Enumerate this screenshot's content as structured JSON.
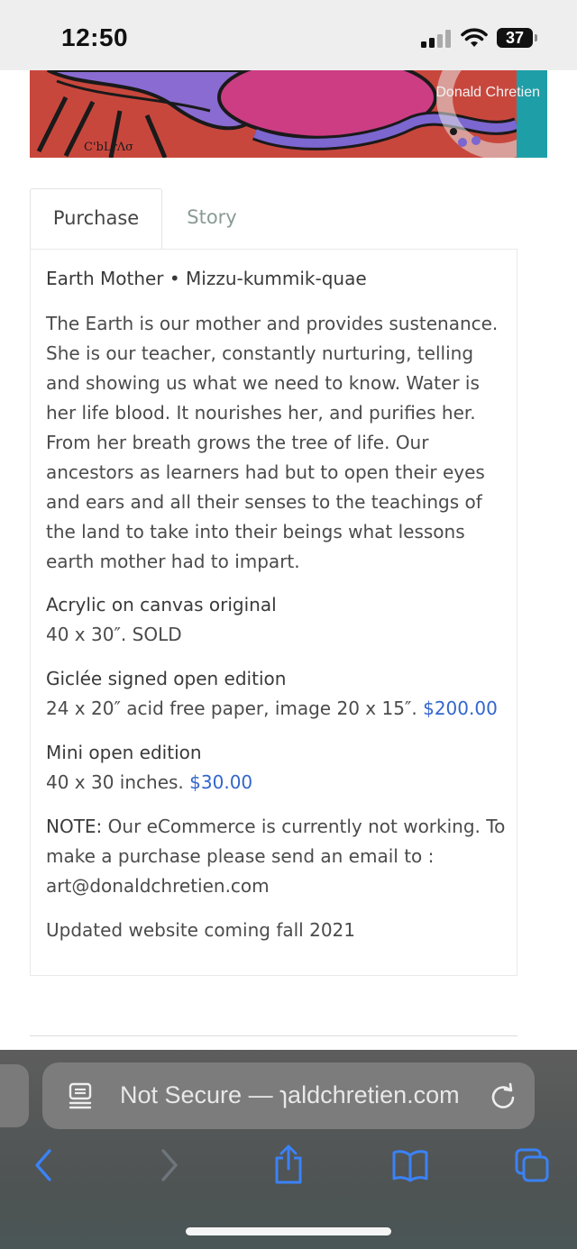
{
  "status_bar": {
    "time": "12:50",
    "battery": "37"
  },
  "hero": {
    "watermark": "Donald Chretien",
    "signature": "C'bLrΛσ"
  },
  "tabs": [
    {
      "label": "Purchase",
      "active": true
    },
    {
      "label": "Story",
      "active": false
    }
  ],
  "artwork": {
    "title": "Earth Mother • Mizzu-kummik-quae",
    "description": "The Earth is our mother and provides sustenance. She is our teacher, constantly nurturing, telling and showing us what we need to know. Water is her life blood. It nourishes her, and purifies her. From her breath grows the tree of life. Our ancestors as learners had but to open their eyes and ears and all their senses to the teachings of the land to take into their beings what lessons earth mother had to impart.",
    "editions": [
      {
        "heading": "Acrylic on canvas original",
        "detail": "40 x 30″.  SOLD",
        "price": ""
      },
      {
        "heading": "Giclée signed open edition",
        "detail": "24 x 20″ acid free paper, image 20 x 15″.  ",
        "price": "$200.00"
      },
      {
        "heading": "Mini open edition",
        "detail": "40 x 30 inches. ",
        "price": "$30.00"
      }
    ],
    "note_label": "NOTE:",
    "note_text": " Our eCommerce is currently not working. To make a purchase please send an email to  : art@donaldchretien.com",
    "updated": "Updated website coming fall 2021"
  },
  "browser": {
    "url_text": "Not Secure — ɿaldchretien.com"
  },
  "colors": {
    "price": "#3366cc",
    "toolbar_icon": "#3b82f6",
    "painting_bg": "#c8473d"
  }
}
